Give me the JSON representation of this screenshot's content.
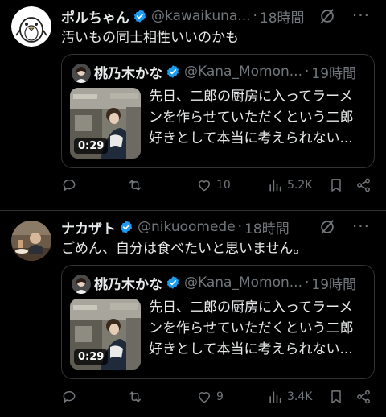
{
  "tweets": [
    {
      "name": "ポルちゃん",
      "handle": "@kawaikuna...",
      "dot": "·",
      "time": "18時間",
      "text": "汚いもの同士相性いいのかも",
      "quote": {
        "name": "桃乃木かな",
        "handle": "@Kana_Momon...",
        "dot": "·",
        "time": "19時間",
        "lines": [
          "先日、二郎の厨房に入ってラーメ",
          "ンを作らせていただくという二郎",
          "好きとして本当に考えられない..."
        ],
        "duration": "0:29"
      },
      "likes": "10",
      "views": "5.2K"
    },
    {
      "name": "ナカザト",
      "handle": "@nikuoomede",
      "dot": "·",
      "time": "18時間",
      "text": "ごめん、自分は食べたいと思いません。",
      "quote": {
        "name": "桃乃木かな",
        "handle": "@Kana_Momon...",
        "dot": "·",
        "time": "19時間",
        "lines": [
          "先日、二郎の厨房に入ってラーメ",
          "ンを作らせていただくという二郎",
          "好きとして本当に考えられない..."
        ],
        "duration": "0:29"
      },
      "likes": "9",
      "views": "3.4K"
    }
  ],
  "more_glyph": "···",
  "colors": {
    "bg": "#000000",
    "text": "#e7e9ea",
    "muted": "#71767b",
    "border": "#2f3336",
    "verified": "#1d9bf0"
  }
}
